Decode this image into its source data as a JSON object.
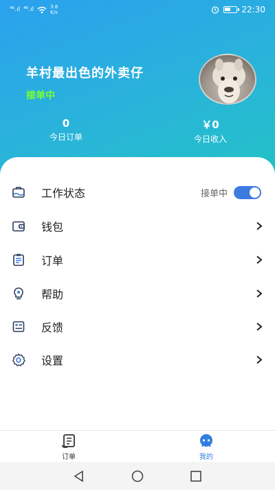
{
  "status_bar": {
    "signal_1": "⁴⁶.ıl",
    "signal_2": "⁴⁶.ıl",
    "net_speed_value": "3.6",
    "net_speed_unit": "K/s",
    "time": "22:30",
    "icons": [
      "signal-icon",
      "wifi-icon",
      "alarm-icon",
      "battery-icon"
    ]
  },
  "profile": {
    "name": "羊村最出色的外卖仔",
    "status": "接单中",
    "status_color": "#7bff2e"
  },
  "stats": {
    "orders_value": "0",
    "orders_label": "今日订单",
    "income_value": "￥0",
    "income_label": "今日收入"
  },
  "menu": {
    "work_status": {
      "label": "工作状态",
      "toggle_label": "接单中",
      "toggle_on": true,
      "icon": "briefcase-icon"
    },
    "wallet": {
      "label": "钱包",
      "icon": "wallet-icon"
    },
    "orders": {
      "label": "订单",
      "icon": "clipboard-icon"
    },
    "help": {
      "label": "帮助",
      "icon": "lightbulb-icon"
    },
    "feedback": {
      "label": "反馈",
      "icon": "feedback-icon"
    },
    "settings": {
      "label": "设置",
      "icon": "gear-icon"
    }
  },
  "tabbar": {
    "orders_label": "订单",
    "me_label": "我的",
    "active_color": "#2f7ee0"
  },
  "colors": {
    "header_gradient_start": "#2aa1ee",
    "header_gradient_end": "#23c3c6",
    "accent": "#3e7be0"
  }
}
